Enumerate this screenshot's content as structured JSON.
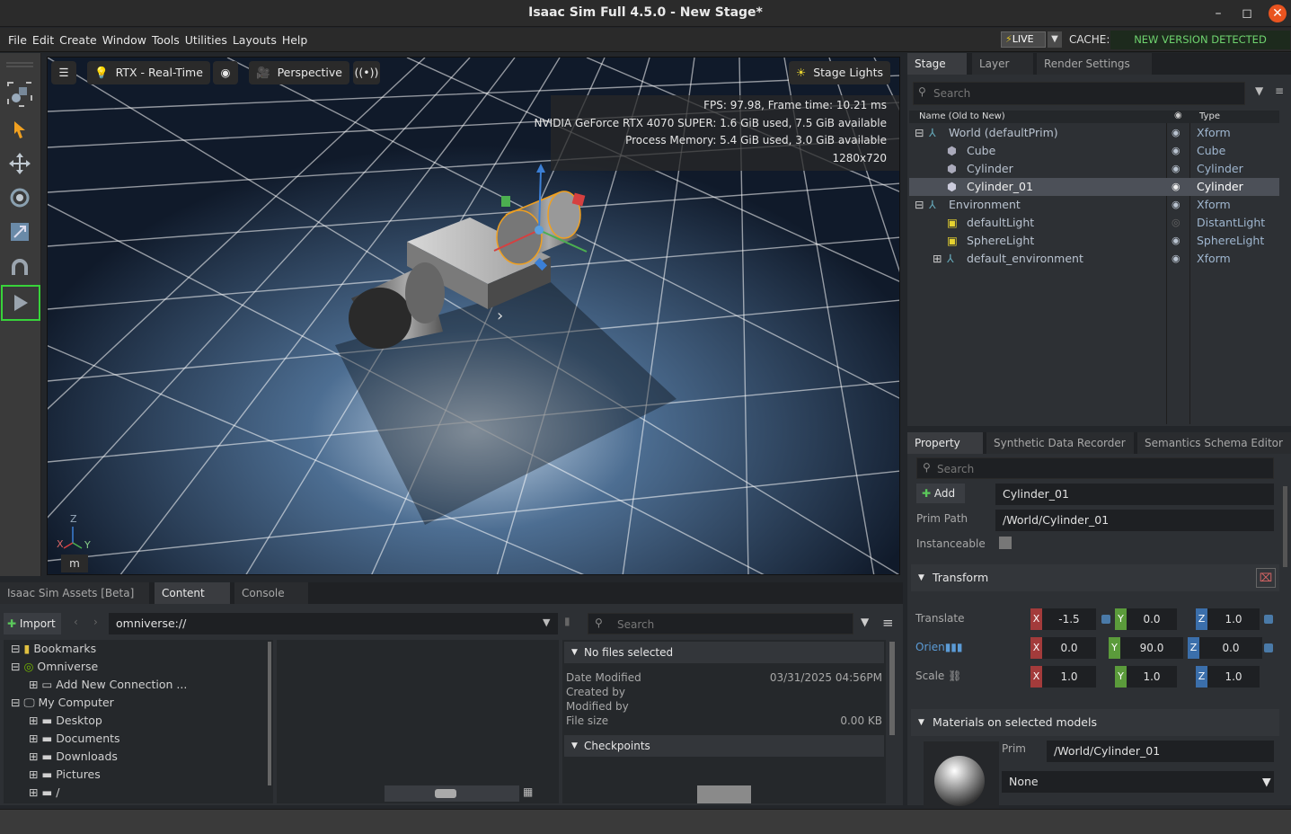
{
  "window": {
    "title": "Isaac Sim Full 4.5.0 - New Stage*"
  },
  "menubar": {
    "items": [
      "File",
      "Edit",
      "Create",
      "Window",
      "Tools",
      "Utilities",
      "Layouts",
      "Help"
    ],
    "live_label": "LIVE",
    "cache_label": "CACHE:",
    "cache_status": "NEW VERSION DETECTED"
  },
  "viewport": {
    "renderer": "RTX - Real-Time",
    "camera": "Perspective",
    "lights": "Stage Lights",
    "stats": [
      "FPS: 97.98, Frame time: 10.21 ms",
      "NVIDIA GeForce RTX 4070 SUPER: 1.6 GiB used, 7.5 GiB available",
      "Process Memory: 5.4 GiB used, 3.0 GiB available",
      "1280x720"
    ],
    "gizmo_label": "m",
    "axes": {
      "x": "X",
      "y": "Y",
      "z": "Z"
    }
  },
  "stage": {
    "tabs": [
      "Stage",
      "Layer",
      "Render Settings"
    ],
    "search_placeholder": "Search",
    "col_name": "Name (Old to New)",
    "col_type": "Type",
    "rows": [
      {
        "name": "World (defaultPrim)",
        "type": "Xform"
      },
      {
        "name": "Cube",
        "type": "Cube"
      },
      {
        "name": "Cylinder",
        "type": "Cylinder"
      },
      {
        "name": "Cylinder_01",
        "type": "Cylinder"
      },
      {
        "name": "Environment",
        "type": "Xform"
      },
      {
        "name": "defaultLight",
        "type": "DistantLight"
      },
      {
        "name": "SphereLight",
        "type": "SphereLight"
      },
      {
        "name": "default_environment",
        "type": "Xform"
      }
    ]
  },
  "property": {
    "tabs": [
      "Property",
      "Synthetic Data Recorder",
      "Semantics Schema Editor"
    ],
    "search_placeholder": "Search",
    "add_label": "Add",
    "prim_name": "Cylinder_01",
    "prim_path_label": "Prim Path",
    "prim_path": "/World/Cylinder_01",
    "instanceable_label": "Instanceable",
    "transform_label": "Transform",
    "translate_label": "Translate",
    "translate": [
      "-1.5",
      "0.0",
      "1.0"
    ],
    "orient_label": "Orien",
    "orient": [
      "0.0",
      "90.0",
      "0.0"
    ],
    "scale_label": "Scale",
    "scale": [
      "1.0",
      "1.0",
      "1.0"
    ],
    "materials_label": "Materials on selected models",
    "prim_label": "Prim",
    "material_prim": "/World/Cylinder_01",
    "material_value": "None"
  },
  "content": {
    "tabs": [
      "Isaac Sim Assets [Beta]",
      "Content",
      "Console"
    ],
    "import_label": "Import",
    "path": "omniverse://",
    "search_placeholder": "Search",
    "tree": [
      "Bookmarks",
      "Omniverse",
      "Add New Connection ...",
      "My Computer",
      "Desktop",
      "Documents",
      "Downloads",
      "Pictures",
      "/"
    ],
    "details": {
      "no_files": "No files selected",
      "date_modified_label": "Date Modified",
      "date_modified": "03/31/2025 04:56PM",
      "created_by_label": "Created by",
      "modified_by_label": "Modified by",
      "file_size_label": "File size",
      "file_size": "0.00 KB",
      "checkpoints": "Checkpoints"
    }
  }
}
